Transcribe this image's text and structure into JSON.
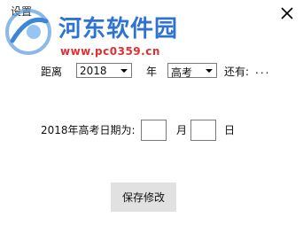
{
  "window": {
    "title": "设置"
  },
  "watermark": {
    "name": "河东软件园",
    "url": "www.pc0359.cn"
  },
  "form": {
    "distance_label": "距离",
    "year_value": "2018",
    "year_unit": "年",
    "exam_value": "高考",
    "remaining_label": "还有:",
    "remaining_value": "...",
    "date_label": "2018年高考日期为:",
    "month_value": "",
    "month_unit": "月",
    "day_value": "",
    "day_unit": "日"
  },
  "buttons": {
    "save_label": "保存修改"
  },
  "colors": {
    "brand_blue": "#2f73d2",
    "url_red": "#e03030",
    "button_bg": "#e1e1e1"
  }
}
